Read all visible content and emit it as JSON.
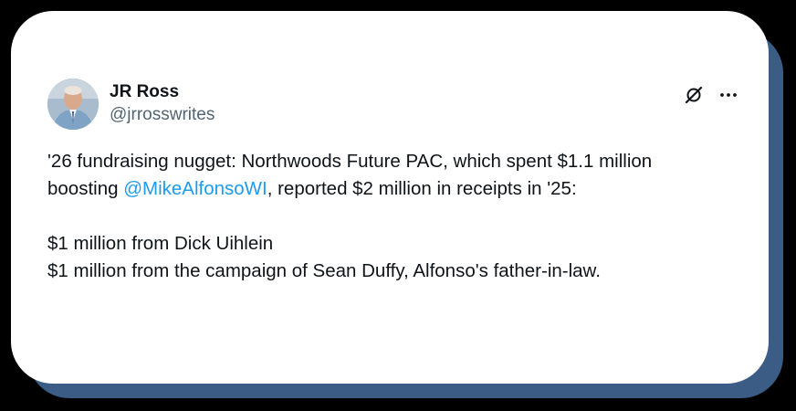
{
  "tweet": {
    "author": {
      "display_name": "JR Ross",
      "handle": "@jrrosswrites"
    },
    "icons": {
      "platform": "grok-slash-icon",
      "menu": "more-options-icon"
    },
    "body": {
      "line1": "'26 fundraising nugget: Northwoods Future PAC, which spent $1.1 million",
      "line2_before": "boosting ",
      "mention": "@MikeAlfonsoWI",
      "line2_after": ", reported $2 million in receipts in '25:",
      "line3": "$1 million from Dick Uihlein",
      "line4": "$1 million from the campaign of Sean Duffy, Alfonso's father-in-law."
    }
  },
  "colors": {
    "text": "#0f1419",
    "secondary": "#536471",
    "mention": "#1d9bf0",
    "shadow": "#3a5c85",
    "background": "#000000"
  }
}
